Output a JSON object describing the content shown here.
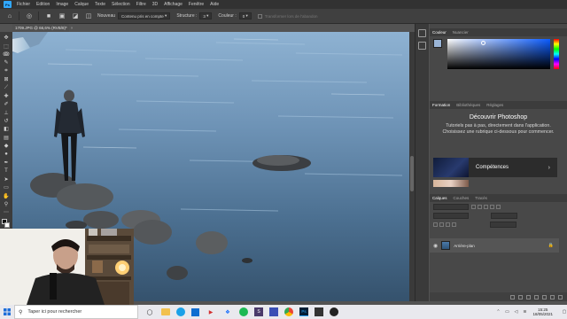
{
  "menubar": {
    "logo": "Ps",
    "items": [
      "Fichier",
      "Edition",
      "Image",
      "Calque",
      "Texte",
      "Sélection",
      "Filtre",
      "3D",
      "Affichage",
      "Fenêtre",
      "Aide"
    ]
  },
  "options": {
    "mode_label": "Nouveau",
    "mode_value": "Contenu pris en compte",
    "structure_label": "Structure :",
    "structure_value": "3",
    "color_label": "Couleur :",
    "color_value": "0",
    "transform_label": "Transformer lors de l'abandon"
  },
  "document": {
    "tab_title": "1709.JPG @ 66,6% (RVB/8)*",
    "close": "×"
  },
  "panels": {
    "color_tabs": [
      "Couleur",
      "Nuancier"
    ],
    "color_fg": "#9ab4d6",
    "learn_tabs": [
      "Formation",
      "Bibliothèques",
      "Réglages"
    ],
    "learn_title": "Découvrir Photoshop",
    "learn_desc": "Tutoriels pas à pas, directement dans l'application. Choisissez une rubrique ci-dessous pour commencer.",
    "learn_card": "Compétences",
    "layers_tabs": [
      "Calques",
      "Couches",
      "Tracés"
    ],
    "layer_name": "Arrière-plan"
  },
  "taskbar": {
    "search_placeholder": "Taper ici pour rechercher",
    "time": "15:25",
    "date": "18/05/2021"
  },
  "colors": {
    "accent": "#31a8ff",
    "water_light": "#8fb3d1",
    "water_dark": "#4f7699"
  }
}
